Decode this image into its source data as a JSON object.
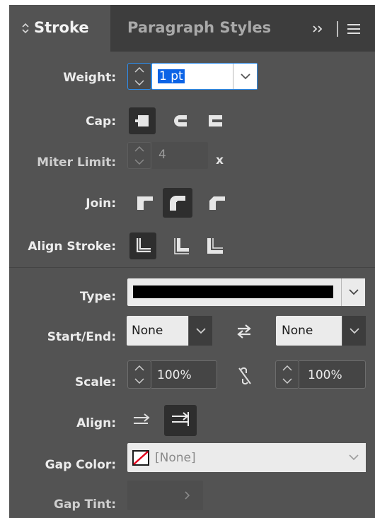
{
  "tabs": [
    {
      "label": "Stroke",
      "active": true
    },
    {
      "label": "Paragraph Styles",
      "active": false
    }
  ],
  "weight": {
    "label": "Weight:",
    "value": "1 pt"
  },
  "cap": {
    "label": "Cap:",
    "selected": "butt-cap"
  },
  "miter": {
    "label": "Miter Limit:",
    "value": "4",
    "suffix": "x"
  },
  "join": {
    "label": "Join:",
    "selected": "round-join"
  },
  "align_stroke": {
    "label": "Align Stroke:",
    "selected": "center"
  },
  "type": {
    "label": "Type:"
  },
  "start_end": {
    "label": "Start/End:",
    "start": "None",
    "end": "None"
  },
  "scale": {
    "label": "Scale:",
    "start": "100%",
    "end": "100%"
  },
  "align": {
    "label": "Align:"
  },
  "gap_color": {
    "label": "Gap Color:",
    "value": "[None]"
  },
  "gap_tint": {
    "label": "Gap Tint:"
  },
  "colors": {
    "panel": "#535353",
    "tabbar": "#3d3d3d",
    "accent": "#2d8ceb",
    "text": "#ececec"
  }
}
